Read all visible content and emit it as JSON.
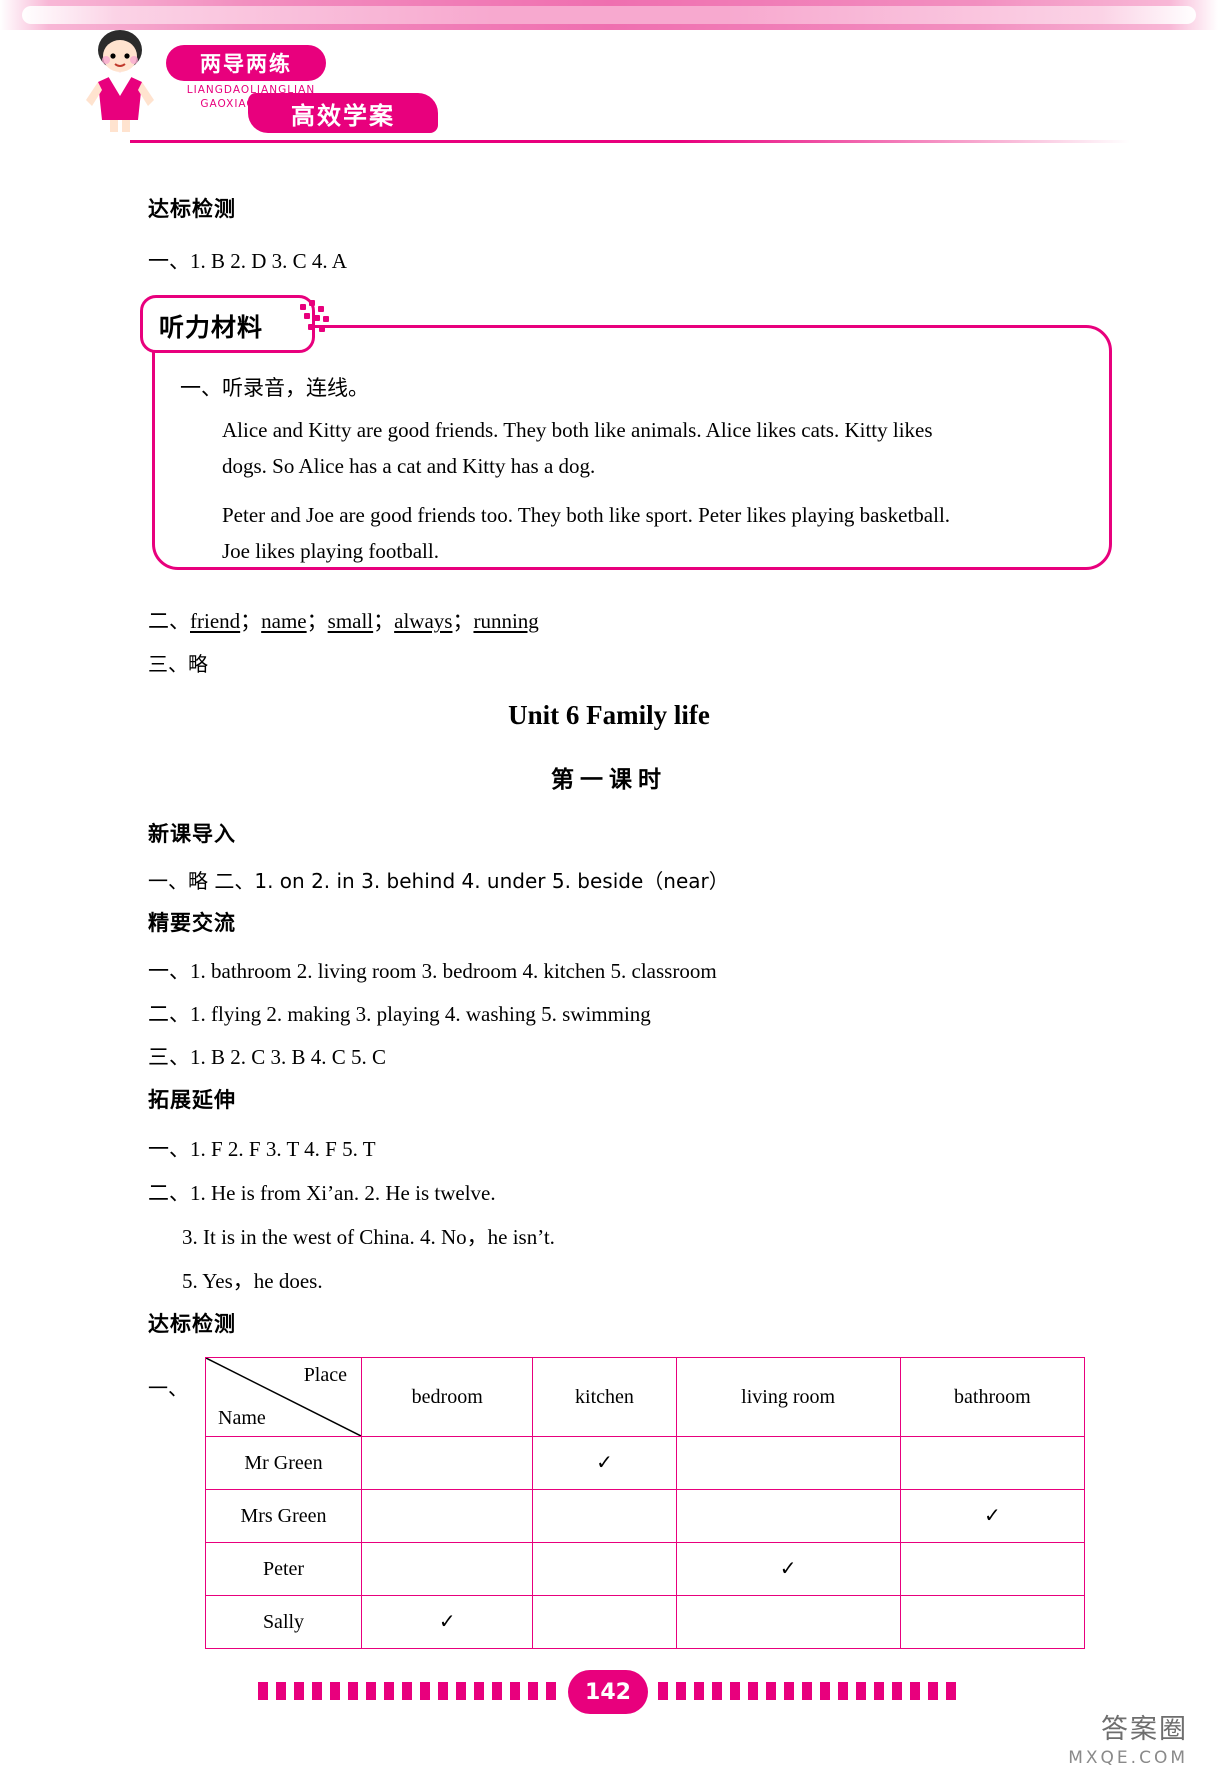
{
  "header": {
    "logo_pill_top": "两导两练",
    "logo_pinyin_line1": "LIANGDAOLIANGLIAN",
    "logo_pinyin_line2": "GAOXIAO XUEAN",
    "logo_pill_bottom": "高效学案"
  },
  "sections": {
    "dabiao_1_title": "达标检测",
    "dabiao_1_answers": "一、1. B   2. D   3. C   4. A",
    "listening_tab": "听力材料",
    "listening_item1": "一、听录音，连线。",
    "listening_p1_line1": "Alice and Kitty are good friends. They both like animals. Alice likes cats. Kitty likes",
    "listening_p1_line2": "dogs. So Alice has a cat and Kitty has a dog.",
    "listening_p2_line1": "Peter and Joe are good friends too. They both like sport. Peter likes playing basketball.",
    "listening_p2_line2": "Joe likes playing football.",
    "answer_2_prefix": "二、",
    "answer_2_words": [
      "friend",
      "name",
      "small",
      "always",
      "running"
    ],
    "answer_3": "三、略",
    "unit_title": "Unit 6  Family life",
    "lesson_title": "第一课时",
    "xinke_title": "新课导入",
    "xinke_answers": "一、略    二、1. on   2. in   3. behind   4. under   5. beside（near）",
    "jingyao_title": "精要交流",
    "jingyao_1": "一、1. bathroom   2. living room   3. bedroom   4. kitchen   5. classroom",
    "jingyao_2": "二、1. flying   2. making   3. playing   4. washing   5. swimming",
    "jingyao_3": "三、1. B   2. C   3. B   4. C   5. C",
    "tuozhan_title": "拓展延伸",
    "tuozhan_1": "一、1. F   2. F   3. T   4. F   5. T",
    "tuozhan_2_line1": "二、1. He is from Xi’an.     2. He is twelve.",
    "tuozhan_2_line2": "3. It is in the west of China.     4. No，he isn’t.",
    "tuozhan_2_line3": "5. Yes，he does.",
    "dabiao_2_title": "达标检测",
    "table_label": "一、"
  },
  "table": {
    "corner_place": "Place",
    "corner_name": "Name",
    "columns": [
      "bedroom",
      "kitchen",
      "living room",
      "bathroom"
    ],
    "check_glyph": "✓",
    "rows": [
      {
        "name": "Mr Green",
        "checks": [
          false,
          true,
          false,
          false
        ]
      },
      {
        "name": "Mrs Green",
        "checks": [
          false,
          false,
          false,
          true
        ]
      },
      {
        "name": "Peter",
        "checks": [
          false,
          false,
          true,
          false
        ]
      },
      {
        "name": "Sally",
        "checks": [
          true,
          false,
          false,
          false
        ]
      }
    ]
  },
  "footer": {
    "page_number": "142",
    "watermark_cn": "答案圈",
    "watermark_en": "MXQE.COM"
  },
  "colors": {
    "accent": "#e8007d",
    "banner_pink": "#f28fc0"
  }
}
